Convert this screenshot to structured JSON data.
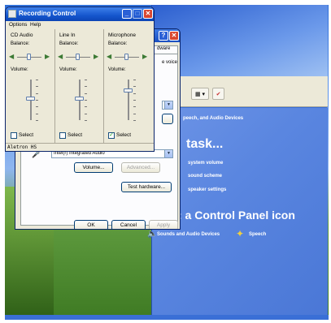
{
  "recording_control": {
    "title": "Recording Control",
    "menu": [
      "Options",
      "Help"
    ],
    "balance_label": "Balance:",
    "volume_label": "Volume:",
    "channels": [
      {
        "name": "CD Audio",
        "select_label": "Select",
        "selected": false,
        "volume_level": 0.55,
        "balance": 0.5
      },
      {
        "name": "Line In",
        "select_label": "Select",
        "selected": false,
        "volume_level": 0.55,
        "balance": 0.5
      },
      {
        "name": "Microphone",
        "select_label": "Select",
        "selected": true,
        "volume_level": 0.75,
        "balance": 0.5
      }
    ],
    "status_text": "Aletron HS"
  },
  "audio_properties": {
    "tab_label": "dware",
    "voice_text": "e voice",
    "device_combo": "Intel(r) Integrated Audio",
    "volume_button": "Volume...",
    "advanced_button": "Advanced...",
    "test_hardware_button": "Test hardware...",
    "ok_button": "OK",
    "cancel_button": "Cancel",
    "apply_button": "Apply"
  },
  "control_panel": {
    "category_header": "peech, and Audio Devices",
    "task_heading": "task...",
    "tasks": [
      "system volume",
      "sound scheme",
      "speaker settings"
    ],
    "icon_heading": ": a Control Panel icon",
    "icons": [
      "Sounds and Audio Devices",
      "Speech"
    ]
  },
  "colors": {
    "xp_title_blue": "#1556cd",
    "dialog_face": "#ece9d8",
    "close_red": "#d8462f",
    "check_green": "#21a121"
  }
}
